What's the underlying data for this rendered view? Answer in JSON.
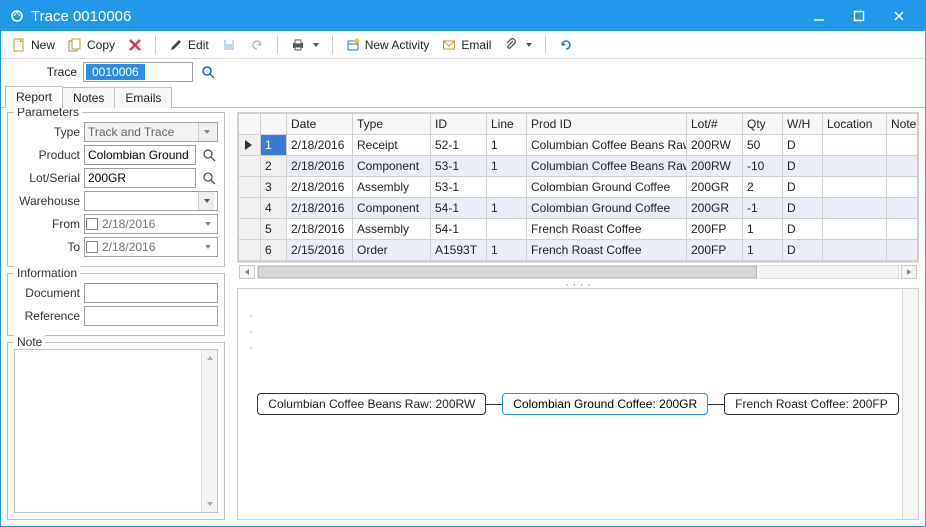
{
  "window": {
    "title": "Trace 0010006"
  },
  "win_controls": {
    "min": "–",
    "max": "❐",
    "close": "✕"
  },
  "toolbar": {
    "new": "New",
    "copy": "Copy",
    "edit": "Edit",
    "new_activity": "New Activity",
    "email": "Email"
  },
  "trace_strip": {
    "label": "Trace",
    "value": "0010006"
  },
  "tabs": {
    "report": "Report",
    "notes": "Notes",
    "emails": "Emails"
  },
  "params": {
    "legend": "Parameters",
    "type_label": "Type",
    "type_value": "Track and Trace",
    "product_label": "Product",
    "product_value": "Colombian Ground Coff",
    "lot_label": "Lot/Serial",
    "lot_value": "200GR",
    "wh_label": "Warehouse",
    "wh_value": "",
    "from_label": "From",
    "from_value": "2/18/2016",
    "to_label": "To",
    "to_value": "2/18/2016"
  },
  "info": {
    "legend": "Information",
    "document_label": "Document",
    "document_value": "",
    "reference_label": "Reference",
    "reference_value": ""
  },
  "note": {
    "legend": "Note"
  },
  "grid": {
    "columns": [
      "",
      "",
      "Date",
      "Type",
      "ID",
      "Line",
      "Prod ID",
      "Lot/#",
      "Qty",
      "W/H",
      "Location",
      "Note"
    ],
    "rows": [
      {
        "n": 1,
        "date": "2/18/2016",
        "type": "Receipt",
        "id": "52-1",
        "line": "1",
        "prod": "Columbian Coffee Beans Raw",
        "lot": "200RW",
        "qty": "50",
        "wh": "D",
        "loc": "",
        "note": ""
      },
      {
        "n": 2,
        "date": "2/18/2016",
        "type": "Component",
        "id": "53-1",
        "line": "1",
        "prod": "Columbian Coffee Beans Raw",
        "lot": "200RW",
        "qty": "-10",
        "wh": "D",
        "loc": "",
        "note": ""
      },
      {
        "n": 3,
        "date": "2/18/2016",
        "type": "Assembly",
        "id": "53-1",
        "line": "",
        "prod": "Colombian Ground Coffee",
        "lot": "200GR",
        "qty": "2",
        "wh": "D",
        "loc": "",
        "note": ""
      },
      {
        "n": 4,
        "date": "2/18/2016",
        "type": "Component",
        "id": "54-1",
        "line": "1",
        "prod": "Colombian Ground Coffee",
        "lot": "200GR",
        "qty": "-1",
        "wh": "D",
        "loc": "",
        "note": ""
      },
      {
        "n": 5,
        "date": "2/18/2016",
        "type": "Assembly",
        "id": "54-1",
        "line": "",
        "prod": "French Roast Coffee",
        "lot": "200FP",
        "qty": "1",
        "wh": "D",
        "loc": "",
        "note": ""
      },
      {
        "n": 6,
        "date": "2/15/2016",
        "type": "Order",
        "id": "A1593T",
        "line": "1",
        "prod": "French Roast Coffee",
        "lot": "200FP",
        "qty": "1",
        "wh": "D",
        "loc": "",
        "note": ""
      }
    ]
  },
  "flow": {
    "nodes": [
      "Columbian Coffee Beans Raw: 200RW",
      "Colombian Ground Coffee: 200GR",
      "French Roast Coffee: 200FP"
    ],
    "active_index": 1
  }
}
